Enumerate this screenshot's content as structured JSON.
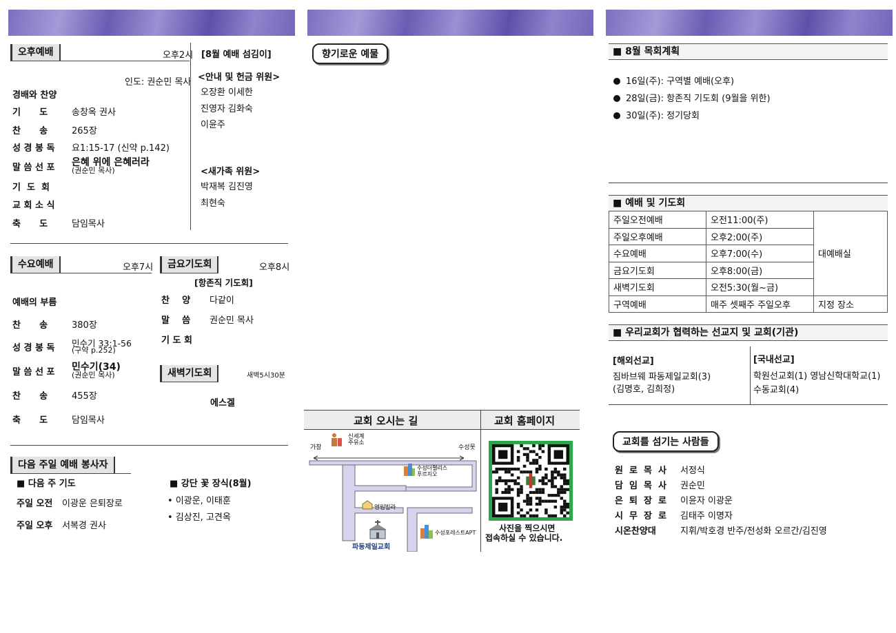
{
  "col1": {
    "afternoon": {
      "title": "오후예배",
      "time": "오후2시",
      "leader": "인도: 권순민 목사",
      "opening": "경배와 찬양",
      "rows": [
        {
          "label": "기      도",
          "value": "송창옥 권사"
        },
        {
          "label": "찬      송",
          "value": "265장"
        },
        {
          "label": "성 경 봉 독",
          "value": "요1:15-17 (신약 p.142)"
        },
        {
          "label": "말 씀 선 포",
          "value": "은혜 위에 은혜러라",
          "sub": "(권순민 목사)"
        },
        {
          "label": "기  도  회",
          "value": ""
        },
        {
          "label": "교 회 소 식",
          "value": ""
        },
        {
          "label": "축      도",
          "value": "담임목사"
        }
      ]
    },
    "helpers": {
      "title": "[8월 예배 섬김이]",
      "usher_title": "<안내 및 헌금 위원>",
      "usher_lines": [
        "오장환 이세한",
        "진영자 김화숙",
        "이윤주"
      ],
      "newfamily_title": "<새가족 위원>",
      "newfamily_lines": [
        "박재복 김진영",
        "최현숙"
      ]
    },
    "wednesday": {
      "title": "수요예배",
      "time": "오후7시",
      "opening": "예배의 부름",
      "rows": [
        {
          "label": "찬      송",
          "value": "380장"
        },
        {
          "label": "성 경 봉 독",
          "value": "민수기 33:1-56",
          "sub": "(구약 p.252)"
        },
        {
          "label": "말 씀 선 포",
          "value": "민수기(34)",
          "sub": "(권순민 목사)"
        },
        {
          "label": "찬      송",
          "value": "455장"
        },
        {
          "label": "축      도",
          "value": "담임목사"
        }
      ]
    },
    "friday": {
      "title": "금요기도회",
      "time": "오후8시",
      "subtitle": "[항존직 기도회]",
      "rows": [
        {
          "label": "찬    양",
          "value": "다같이"
        },
        {
          "label": "말    씀",
          "value": "권순민 목사"
        },
        {
          "label": "기 도 회",
          "value": ""
        }
      ]
    },
    "dawn": {
      "title": "새벽기도회",
      "time": "새벽5시30분",
      "book": "에스겔"
    },
    "next": {
      "title": "다음 주일 예배 봉사자",
      "prayer_title": "■ 다음 주 기도",
      "prayer_rows": [
        {
          "label": "주일 오전",
          "value": "이광운 은퇴장로"
        },
        {
          "label": "주일 오후",
          "value": "서복경 권사"
        }
      ],
      "flower_title": "■ 강단 꽃 장식(8월)",
      "flower_lines": [
        "• 이광운, 이태훈",
        "• 김상진, 고견옥"
      ]
    }
  },
  "col2": {
    "offering_title": "향기로운 예물",
    "directions_title": "교회 오시는 길",
    "homepage_title": "교회 홈페이지",
    "map": {
      "gas": "신세계\n주유소",
      "left_end": "가창",
      "right_end": "수성못",
      "apt1": "수성더펠리스\n푸르지오",
      "villa": "영림빌라",
      "apt2": "수성포레스트APT",
      "church": "파동제일교회"
    },
    "qr_caption_1": "사진을 찍으시면",
    "qr_caption_2": "접속하실 수 있습니다."
  },
  "col3": {
    "plan_title": "■  8월 목회계획",
    "plan_items": [
      "16일(주): 구역별 예배(오후)",
      "28일(금): 항존직 기도회 (9월을 위한)",
      "30일(주): 정기당회"
    ],
    "schedule_title": "■  예배 및 기도회",
    "schedule": [
      {
        "name": "주일오전예배",
        "time": "오전11:00(주)"
      },
      {
        "name": "주일오후예배",
        "time": "오후2:00(주)"
      },
      {
        "name": "수요예배",
        "time": "오후7:00(수)"
      },
      {
        "name": "금요기도회",
        "time": "오후8:00(금)"
      },
      {
        "name": "새벽기도회",
        "time": "오전5:30(월~금)"
      }
    ],
    "schedule_place": "대예배실",
    "district": {
      "name": "구역예배",
      "time": "매주 셋째주 주일오후",
      "place": "지정 장소"
    },
    "mission_title": "■  우리교회가 협력하는 선교지 및 교회(기관)",
    "overseas_title": "[해외선교]",
    "overseas_lines": [
      "짐바브웨 파동제일교회(3)",
      "(김명호, 김희정)"
    ],
    "domestic_title": "[국내선교]",
    "domestic_lines": [
      "학원선교회(1)  영남신학대학교(1)",
      "수동교회(4)"
    ],
    "servants_title": "교회를 섬기는 사람들",
    "servants": [
      {
        "label": "원  로  목  사",
        "value": "서정식"
      },
      {
        "label": "담  임  목  사",
        "value": "권순민"
      },
      {
        "label": "은  퇴  장  로",
        "value": "이윤자 이광운"
      },
      {
        "label": "시  무  장  로",
        "value": "김태주 이명자"
      },
      {
        "label": "시온찬양대",
        "value": "지휘/박호경   반주/전성화   오르간/김진영"
      }
    ]
  }
}
